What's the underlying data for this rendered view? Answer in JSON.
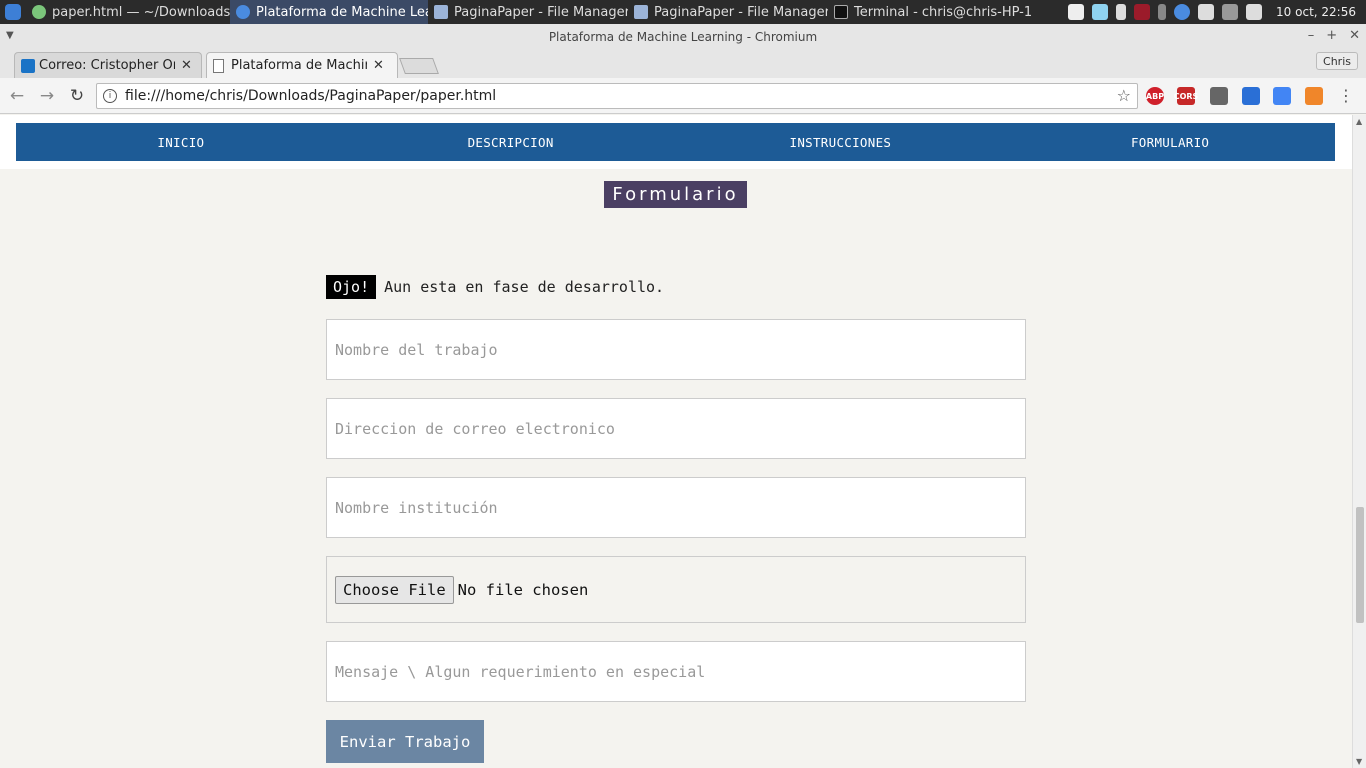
{
  "taskbar": {
    "windows": [
      {
        "label": "paper.html — ~/Downloads/..."
      },
      {
        "label": "Plataforma de Machine Lear..."
      },
      {
        "label": "PaginaPaper - File Manager"
      },
      {
        "label": "PaginaPaper - File Manager"
      },
      {
        "label": "Terminal - chris@chris-HP-1..."
      }
    ],
    "clock": "10 oct, 22:56"
  },
  "browser": {
    "window_title": "Plataforma de Machine Learning - Chromium",
    "tabs": [
      {
        "title": "Correo: Cristopher Orell"
      },
      {
        "title": "Plataforma de Machine"
      }
    ],
    "profile": "Chris",
    "url": "file:///home/chris/Downloads/PaginaPaper/paper.html",
    "extensions": [
      "ABP",
      "CORS"
    ]
  },
  "page": {
    "nav": [
      "INICIO",
      "DESCRIPCION",
      "INSTRUCCIONES",
      "FORMULARIO"
    ],
    "section_title": "Formulario",
    "warning_badge": "Ojo!",
    "warning_text": "Aun esta en fase de desarrollo.",
    "form": {
      "job_name_placeholder": "Nombre del trabajo",
      "email_placeholder": "Direccion de correo electronico",
      "institution_placeholder": "Nombre institución",
      "file_button": "Choose File",
      "file_status": "No file chosen",
      "message_placeholder": "Mensaje \\ Algun requerimiento en especial",
      "submit_label": "Enviar Trabajo"
    }
  },
  "colors": {
    "navbar": "#1d5b96",
    "section_title_bg": "#4a3f63",
    "submit_bg": "#6b86a3",
    "page_bg": "#f4f3ef"
  }
}
